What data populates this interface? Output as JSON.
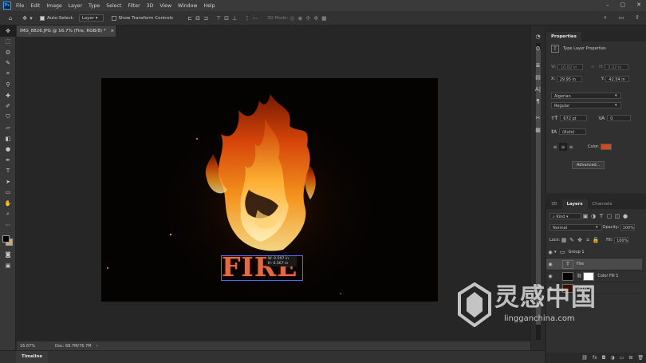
{
  "menubar": {
    "logo": "Ps",
    "items": [
      "File",
      "Edit",
      "Image",
      "Layer",
      "Type",
      "Select",
      "Filter",
      "3D",
      "View",
      "Window",
      "Help"
    ],
    "window_controls": [
      "–",
      "▢",
      "✕"
    ]
  },
  "options": {
    "auto_select_label": "Auto-Select:",
    "auto_select_checked": true,
    "auto_select_target": "Layer",
    "show_transform_label": "Show Transform Controls",
    "mode_label": "3D Mode:"
  },
  "document": {
    "tab_title": "IMG_8826.JPG @ 16.7% (Fire, RGB/8) *",
    "word": "FIRE",
    "info_w": "W: 0.097 in",
    "info_h": "H: 0.567 in"
  },
  "status": {
    "zoom": "16.67%",
    "doc": "Doc: 68.7M/76.7M"
  },
  "timeline": {
    "label": "Timeline"
  },
  "properties": {
    "tab": "Properties",
    "header": "Type Layer Properties",
    "w_label": "W:",
    "w_value": "10.82 in",
    "h_label": "H:",
    "h_value": "3.32 in",
    "x_label": "X:",
    "x_value": "29.95 in",
    "y_label": "Y:",
    "y_value": "42.54 in",
    "font_family": "Algerian",
    "font_style": "Regular",
    "font_size": "672 pt",
    "tracking": "0",
    "leading": "(Auto)",
    "color_label": "Color:",
    "color": "#d14a1c",
    "advanced_label": "Advanced..."
  },
  "layers": {
    "tabs": [
      "3D",
      "Layers",
      "Channels"
    ],
    "active_tab": "Layers",
    "kind_label": "Kind",
    "blend_mode": "Normal",
    "opacity_label": "Opacity:",
    "opacity_value": "100%",
    "lock_label": "Lock:",
    "fill_label": "Fill:",
    "fill_value": "100%",
    "items": [
      {
        "name": "Group 1",
        "type": "group"
      },
      {
        "name": "Fire",
        "type": "text"
      },
      {
        "name": "Color Fill 1",
        "type": "fill"
      },
      {
        "name": "Layer 0",
        "type": "image"
      }
    ]
  },
  "watermark": {
    "cn": "灵感中国",
    "en": "lingganchina.com"
  }
}
